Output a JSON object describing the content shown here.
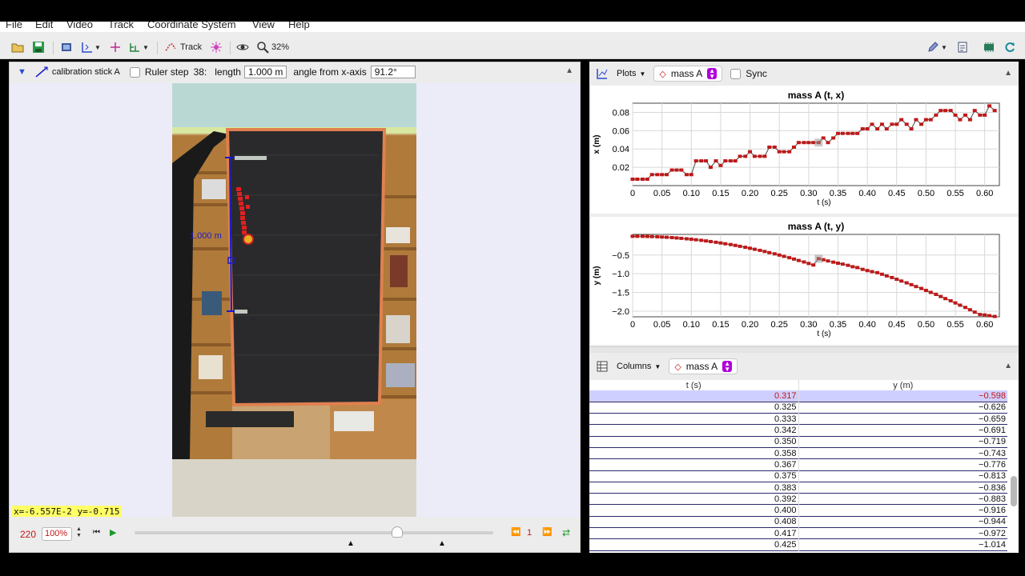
{
  "menu": [
    "File",
    "Edit",
    "Video",
    "Track",
    "Coordinate System",
    "View",
    "Help"
  ],
  "toolbar": {
    "track_label": "Track",
    "zoom_label": "32%"
  },
  "trackbar": {
    "track_name": "calibration stick A",
    "ruler_label": "Ruler step",
    "step_number": "38:",
    "length_label": "length",
    "length_value": "1.000 m",
    "angle_label": "angle from x-axis",
    "angle_value": "91.2°"
  },
  "video": {
    "stick_label": "1.000 m"
  },
  "status": {
    "coord_readout": "x=-6.557E-2  y=-0.715"
  },
  "player": {
    "frame": "220",
    "rate": "100%",
    "step_count": "1"
  },
  "plots_panel": {
    "menu_label": "Plots",
    "track_selector": "mass A",
    "sync_label": "Sync"
  },
  "table_panel": {
    "menu_label": "Columns",
    "track_selector": "mass A"
  },
  "colors": {
    "accent_red": "#c01818",
    "selected_row": "#cfcfff",
    "trail": "#e02020",
    "calibration": "#1a1acc",
    "coord_bg": "#ffff66"
  },
  "chart_data": [
    {
      "type": "line",
      "title": "mass A (t, x)",
      "xlabel": "t (s)",
      "ylabel": "x (m)",
      "xlim": [
        0,
        0.625
      ],
      "ylim": [
        0,
        0.09
      ],
      "xticks": [
        "0",
        "0.05",
        "0.10",
        "0.15",
        "0.20",
        "0.25",
        "0.30",
        "0.35",
        "0.40",
        "0.45",
        "0.50",
        "0.55",
        "0.60"
      ],
      "yticks": [
        "0.02",
        "0.04",
        "0.06",
        "0.08"
      ],
      "highlight_x": 0.317,
      "series": [
        {
          "x": [
            0,
            0.008,
            0.017,
            0.025,
            0.033,
            0.042,
            0.05,
            0.058,
            0.067,
            0.075,
            0.083,
            0.092,
            0.1,
            0.108,
            0.117,
            0.125,
            0.133,
            0.142,
            0.15,
            0.158,
            0.167,
            0.175,
            0.183,
            0.192,
            0.2,
            0.208,
            0.217,
            0.225,
            0.233,
            0.242,
            0.25,
            0.258,
            0.267,
            0.275,
            0.283,
            0.292,
            0.3,
            0.308,
            0.317,
            0.325,
            0.333,
            0.342,
            0.35,
            0.358,
            0.367,
            0.375,
            0.383,
            0.392,
            0.4,
            0.408,
            0.417,
            0.425,
            0.433,
            0.442,
            0.45,
            0.458,
            0.467,
            0.475,
            0.483,
            0.492,
            0.5,
            0.508,
            0.517,
            0.525,
            0.533,
            0.542,
            0.55,
            0.558,
            0.567,
            0.575,
            0.583,
            0.592,
            0.6,
            0.608,
            0.617
          ],
          "y": [
            0.007,
            0.007,
            0.007,
            0.007,
            0.012,
            0.012,
            0.012,
            0.012,
            0.017,
            0.017,
            0.017,
            0.012,
            0.012,
            0.027,
            0.027,
            0.027,
            0.02,
            0.027,
            0.022,
            0.027,
            0.027,
            0.027,
            0.032,
            0.032,
            0.037,
            0.032,
            0.032,
            0.032,
            0.042,
            0.042,
            0.037,
            0.037,
            0.037,
            0.042,
            0.047,
            0.047,
            0.047,
            0.047,
            0.047,
            0.052,
            0.047,
            0.052,
            0.057,
            0.057,
            0.057,
            0.057,
            0.057,
            0.062,
            0.062,
            0.067,
            0.062,
            0.067,
            0.062,
            0.067,
            0.067,
            0.072,
            0.067,
            0.062,
            0.072,
            0.067,
            0.072,
            0.072,
            0.077,
            0.082,
            0.082,
            0.082,
            0.077,
            0.072,
            0.077,
            0.072,
            0.082,
            0.077,
            0.077,
            0.087,
            0.082
          ]
        }
      ]
    },
    {
      "type": "line",
      "title": "mass A (t, y)",
      "xlabel": "t (s)",
      "ylabel": "y (m)",
      "xlim": [
        0,
        0.625
      ],
      "ylim": [
        -2.15,
        0.05
      ],
      "xticks": [
        "0",
        "0.05",
        "0.10",
        "0.15",
        "0.20",
        "0.25",
        "0.30",
        "0.35",
        "0.40",
        "0.45",
        "0.50",
        "0.55",
        "0.60"
      ],
      "yticks": [
        "-0.5",
        "-1.0",
        "-1.5",
        "-2.0"
      ],
      "highlight_x": 0.317,
      "series": [
        {
          "x": [
            0,
            0.008,
            0.017,
            0.025,
            0.033,
            0.042,
            0.05,
            0.058,
            0.067,
            0.075,
            0.083,
            0.092,
            0.1,
            0.108,
            0.117,
            0.125,
            0.133,
            0.142,
            0.15,
            0.158,
            0.167,
            0.175,
            0.183,
            0.192,
            0.2,
            0.208,
            0.217,
            0.225,
            0.233,
            0.242,
            0.25,
            0.258,
            0.267,
            0.275,
            0.283,
            0.292,
            0.3,
            0.308,
            0.317,
            0.325,
            0.333,
            0.342,
            0.35,
            0.358,
            0.367,
            0.375,
            0.383,
            0.392,
            0.4,
            0.408,
            0.417,
            0.425,
            0.433,
            0.442,
            0.45,
            0.458,
            0.467,
            0.475,
            0.483,
            0.492,
            0.5,
            0.508,
            0.517,
            0.525,
            0.533,
            0.542,
            0.55,
            0.558,
            0.567,
            0.575,
            0.583,
            0.592,
            0.6,
            0.608,
            0.617
          ],
          "y": [
            -0.0,
            -0.001,
            -0.002,
            -0.005,
            -0.009,
            -0.014,
            -0.02,
            -0.027,
            -0.035,
            -0.045,
            -0.055,
            -0.067,
            -0.079,
            -0.093,
            -0.108,
            -0.124,
            -0.141,
            -0.16,
            -0.179,
            -0.2,
            -0.221,
            -0.244,
            -0.268,
            -0.294,
            -0.32,
            -0.347,
            -0.376,
            -0.406,
            -0.437,
            -0.469,
            -0.502,
            -0.536,
            -0.572,
            -0.608,
            -0.646,
            -0.686,
            -0.726,
            -0.767,
            -0.598,
            -0.626,
            -0.659,
            -0.691,
            -0.719,
            -0.743,
            -0.776,
            -0.813,
            -0.836,
            -0.883,
            -0.916,
            -0.944,
            -0.972,
            -1.014,
            -1.058,
            -1.102,
            -1.148,
            -1.195,
            -1.243,
            -1.292,
            -1.342,
            -1.393,
            -1.445,
            -1.498,
            -1.552,
            -1.608,
            -1.664,
            -1.722,
            -1.78,
            -1.84,
            -1.9,
            -1.962,
            -2.025,
            -2.088,
            -2.1,
            -2.12,
            -2.14
          ]
        }
      ]
    },
    {
      "type": "table",
      "columns": [
        "t (s)",
        "y (m)"
      ],
      "rows": [
        [
          "0.317",
          "-0.598"
        ],
        [
          "0.325",
          "-0.626"
        ],
        [
          "0.333",
          "-0.659"
        ],
        [
          "0.342",
          "-0.691"
        ],
        [
          "0.350",
          "-0.719"
        ],
        [
          "0.358",
          "-0.743"
        ],
        [
          "0.367",
          "-0.776"
        ],
        [
          "0.375",
          "-0.813"
        ],
        [
          "0.383",
          "-0.836"
        ],
        [
          "0.392",
          "-0.883"
        ],
        [
          "0.400",
          "-0.916"
        ],
        [
          "0.408",
          "-0.944"
        ],
        [
          "0.417",
          "-0.972"
        ],
        [
          "0.425",
          "-1.014"
        ]
      ],
      "selected_row": 0
    }
  ]
}
